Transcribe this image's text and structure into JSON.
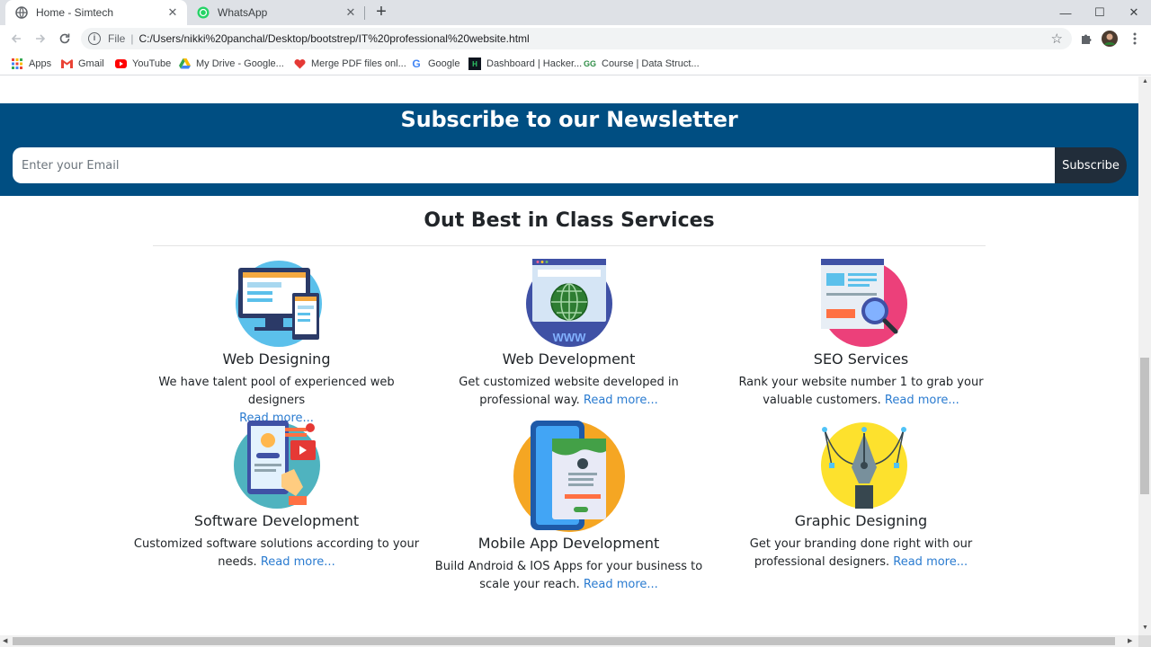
{
  "browser": {
    "tabs": [
      {
        "title": "Home - Simtech",
        "icon": "globe-icon"
      },
      {
        "title": "WhatsApp",
        "icon": "whatsapp-icon"
      }
    ],
    "close_glyph": "✕",
    "new_tab_glyph": "+",
    "window_controls": {
      "minimize": "—",
      "maximize": "☐",
      "close": "✕"
    },
    "address_scheme": "File",
    "address_url": "C:/Users/nikki%20panchal/Desktop/bootstrep/IT%20professional%20website.html",
    "bookmarks": [
      {
        "label": "Apps",
        "icon": "apps-grid-icon"
      },
      {
        "label": "Gmail",
        "icon": "gmail-icon"
      },
      {
        "label": "YouTube",
        "icon": "youtube-icon"
      },
      {
        "label": "My Drive - Google...",
        "icon": "drive-icon"
      },
      {
        "label": "Merge PDF files onl...",
        "icon": "heart-icon"
      },
      {
        "label": "Google",
        "icon": "google-icon"
      },
      {
        "label": "Dashboard | Hacker...",
        "icon": "hackerrank-icon"
      },
      {
        "label": "Course | Data Struct...",
        "icon": "gfg-icon"
      }
    ]
  },
  "newsletter": {
    "title": "Subscribe to our Newsletter",
    "email_placeholder": "Enter your Email",
    "button_label": "Subscribe",
    "bg_color": "#004e82"
  },
  "services": {
    "title": "Out Best in Class Services",
    "read_more": "Read more...",
    "items": [
      {
        "name": "Web Designing",
        "desc": "We have talent pool of experienced web designers",
        "icon": "web-design-icon"
      },
      {
        "name": "Web Development",
        "desc": "Get customized website developed in professional way.",
        "icon": "web-development-icon"
      },
      {
        "name": "SEO Services",
        "desc": "Rank your website number 1 to grab your valuable customers.",
        "icon": "seo-icon"
      },
      {
        "name": "Software Development",
        "desc": "Customized software solutions according to your needs.",
        "icon": "software-development-icon"
      },
      {
        "name": "Mobile App Development",
        "desc": "Build Android & IOS Apps for your business to scale your reach.",
        "icon": "mobile-app-icon"
      },
      {
        "name": "Graphic Designing",
        "desc": "Get your branding done right with our professional designers.",
        "icon": "pen-tool-icon"
      }
    ]
  }
}
